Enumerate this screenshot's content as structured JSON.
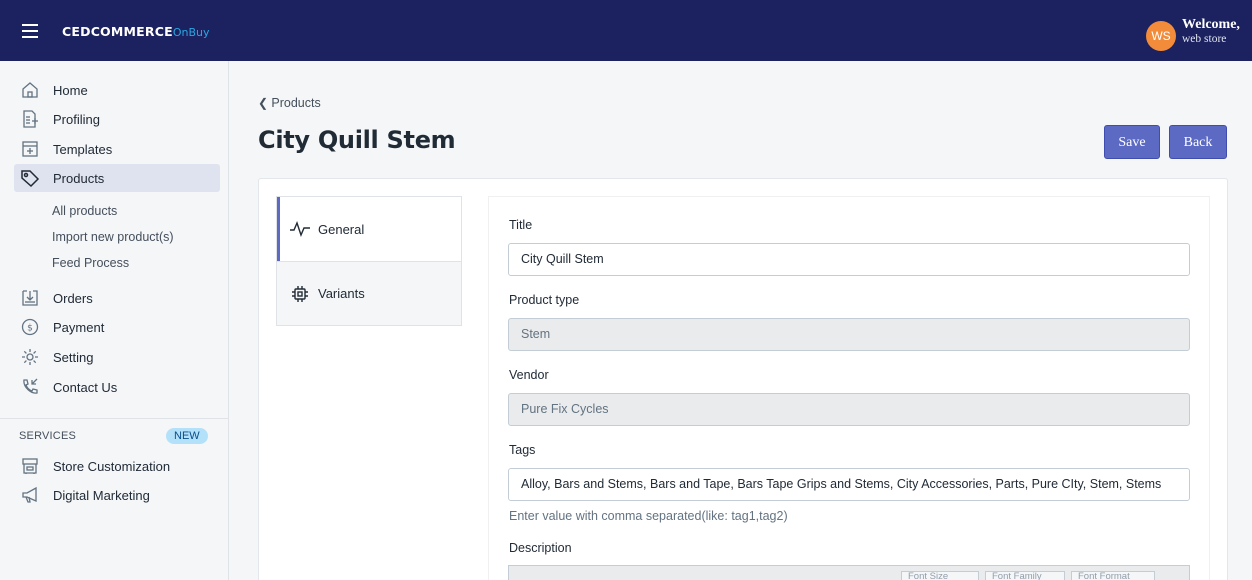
{
  "header": {
    "brand_main": "CEDCOMMERCE",
    "brand_sub": "OnBuy",
    "avatar_initials": "WS",
    "welcome": "Welcome,",
    "user": "web store"
  },
  "sidebar": {
    "items": [
      {
        "label": "Home",
        "icon": "home-icon"
      },
      {
        "label": "Profiling",
        "icon": "profiling-icon"
      },
      {
        "label": "Templates",
        "icon": "templates-icon"
      },
      {
        "label": "Products",
        "icon": "tag-icon",
        "active": true
      },
      {
        "label": "Orders",
        "icon": "orders-icon"
      },
      {
        "label": "Payment",
        "icon": "payment-icon"
      },
      {
        "label": "Setting",
        "icon": "gear-icon"
      },
      {
        "label": "Contact Us",
        "icon": "phone-icon"
      }
    ],
    "product_sub": [
      "All products",
      "Import new product(s)",
      "Feed Process"
    ],
    "services_label": "SERVICES",
    "services_badge": "NEW",
    "services": [
      {
        "label": "Store Customization",
        "icon": "store-icon"
      },
      {
        "label": "Digital Marketing",
        "icon": "megaphone-icon"
      }
    ]
  },
  "page": {
    "breadcrumb": "Products",
    "title": "City Quill Stem",
    "save_label": "Save",
    "back_label": "Back"
  },
  "tabs": [
    {
      "label": "General",
      "icon": "activity-icon",
      "active": true
    },
    {
      "label": "Variants",
      "icon": "chip-icon"
    }
  ],
  "form": {
    "title_label": "Title",
    "title_value": "City Quill Stem",
    "type_label": "Product type",
    "type_value": "Stem",
    "vendor_label": "Vendor",
    "vendor_value": "Pure Fix Cycles",
    "tags_label": "Tags",
    "tags_value": "Alloy, Bars and Stems, Bars and Tape, Bars Tape Grips and Stems, City Accessories, Parts, Pure CIty, Stem, Stems",
    "tags_hint": "Enter value with comma separated(like: tag1,tag2)",
    "description_label": "Description",
    "editor_font_size": "Font Size",
    "editor_font_family": "Font Family",
    "editor_font_format": "Font Format"
  }
}
